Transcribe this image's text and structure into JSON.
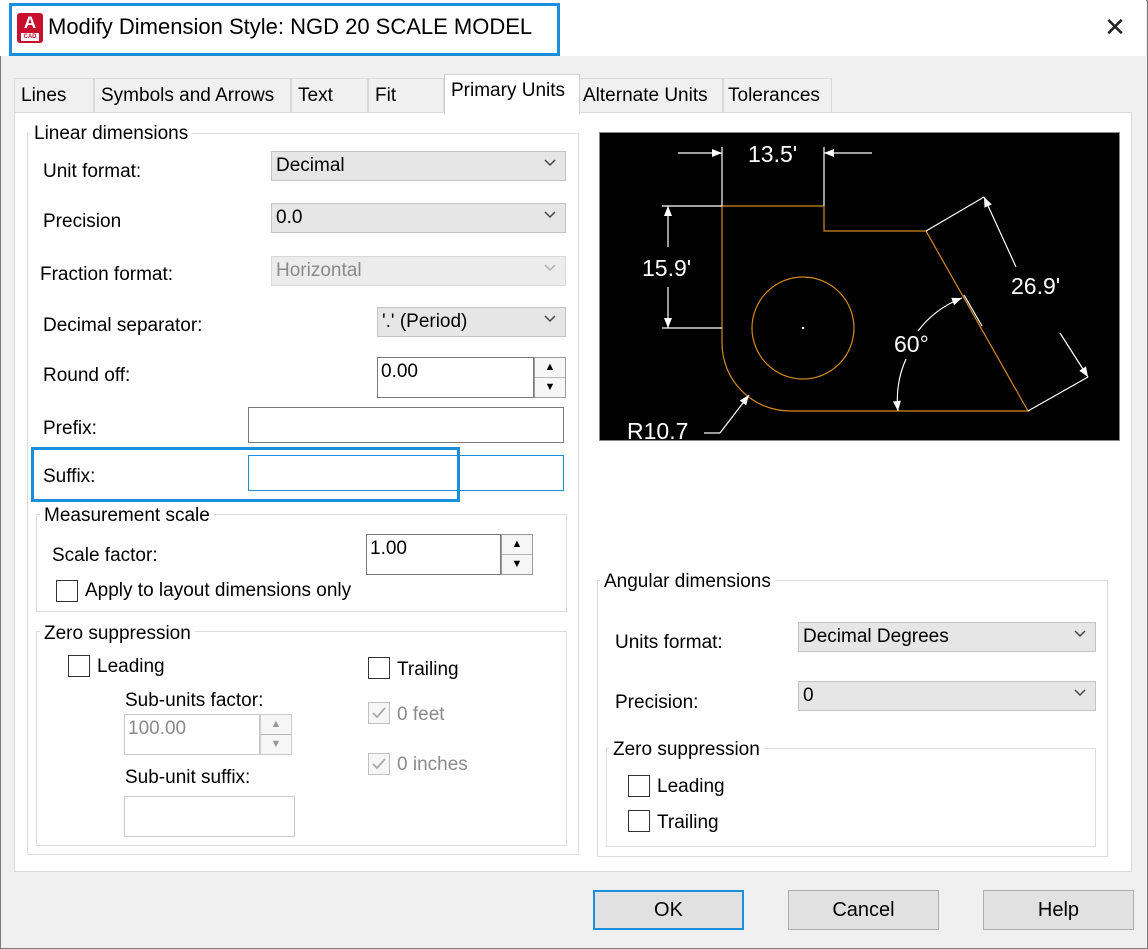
{
  "window": {
    "title": "Modify Dimension Style: NGD 20 SCALE MODEL",
    "icon_letter": "A",
    "icon_sub": "CAD",
    "close_glyph": "✕"
  },
  "tabs": [
    {
      "label": "Lines",
      "active": false
    },
    {
      "label": "Symbols and Arrows",
      "active": false
    },
    {
      "label": "Text",
      "active": false
    },
    {
      "label": "Fit",
      "active": false
    },
    {
      "label": "Primary Units",
      "active": true
    },
    {
      "label": "Alternate Units",
      "active": false
    },
    {
      "label": "Tolerances",
      "active": false
    }
  ],
  "linear": {
    "legend": "Linear dimensions",
    "unit_format": {
      "label": "Unit format:",
      "value": "Decimal"
    },
    "precision": {
      "label": "Precision",
      "value": "0.0"
    },
    "fraction_format": {
      "label": "Fraction format:",
      "value": "Horizontal",
      "disabled": true
    },
    "decimal_separator": {
      "label": "Decimal separator:",
      "value": "'.' (Period)"
    },
    "round_off": {
      "label": "Round off:",
      "value": "0.00"
    },
    "prefix": {
      "label": "Prefix:",
      "value": ""
    },
    "suffix": {
      "label": "Suffix:",
      "value": ""
    }
  },
  "measurement": {
    "legend": "Measurement scale",
    "scale_factor": {
      "label": "Scale factor:",
      "value": "1.00"
    },
    "layout_only": {
      "label": "Apply to layout dimensions only",
      "checked": false
    }
  },
  "zero_linear": {
    "legend": "Zero suppression",
    "leading": {
      "label": "Leading",
      "checked": false
    },
    "trailing": {
      "label": "Trailing",
      "checked": false
    },
    "sub_units_factor": {
      "label": "Sub-units factor:",
      "value": "100.00"
    },
    "sub_unit_suffix": {
      "label": "Sub-unit suffix:",
      "value": ""
    },
    "feet": {
      "label": "0 feet",
      "checked": true,
      "disabled": true
    },
    "inches": {
      "label": "0 inches",
      "checked": true,
      "disabled": true
    }
  },
  "preview": {
    "top_dim": "13.5'",
    "left_dim": "15.9'",
    "diag_dim": "26.9'",
    "angle_dim": "60°",
    "radius_dim": "R10.7",
    "geometry_color": "#d08a1e"
  },
  "angular": {
    "legend": "Angular dimensions",
    "units_format": {
      "label": "Units format:",
      "value": "Decimal Degrees"
    },
    "precision": {
      "label": "Precision:",
      "value": "0"
    },
    "zero_legend": "Zero suppression",
    "leading": {
      "label": "Leading",
      "checked": false
    },
    "trailing": {
      "label": "Trailing",
      "checked": false
    }
  },
  "buttons": {
    "ok": "OK",
    "cancel": "Cancel",
    "help": "Help"
  },
  "colors": {
    "highlight": "#1a8fdc",
    "app_icon": "#c8102e"
  }
}
